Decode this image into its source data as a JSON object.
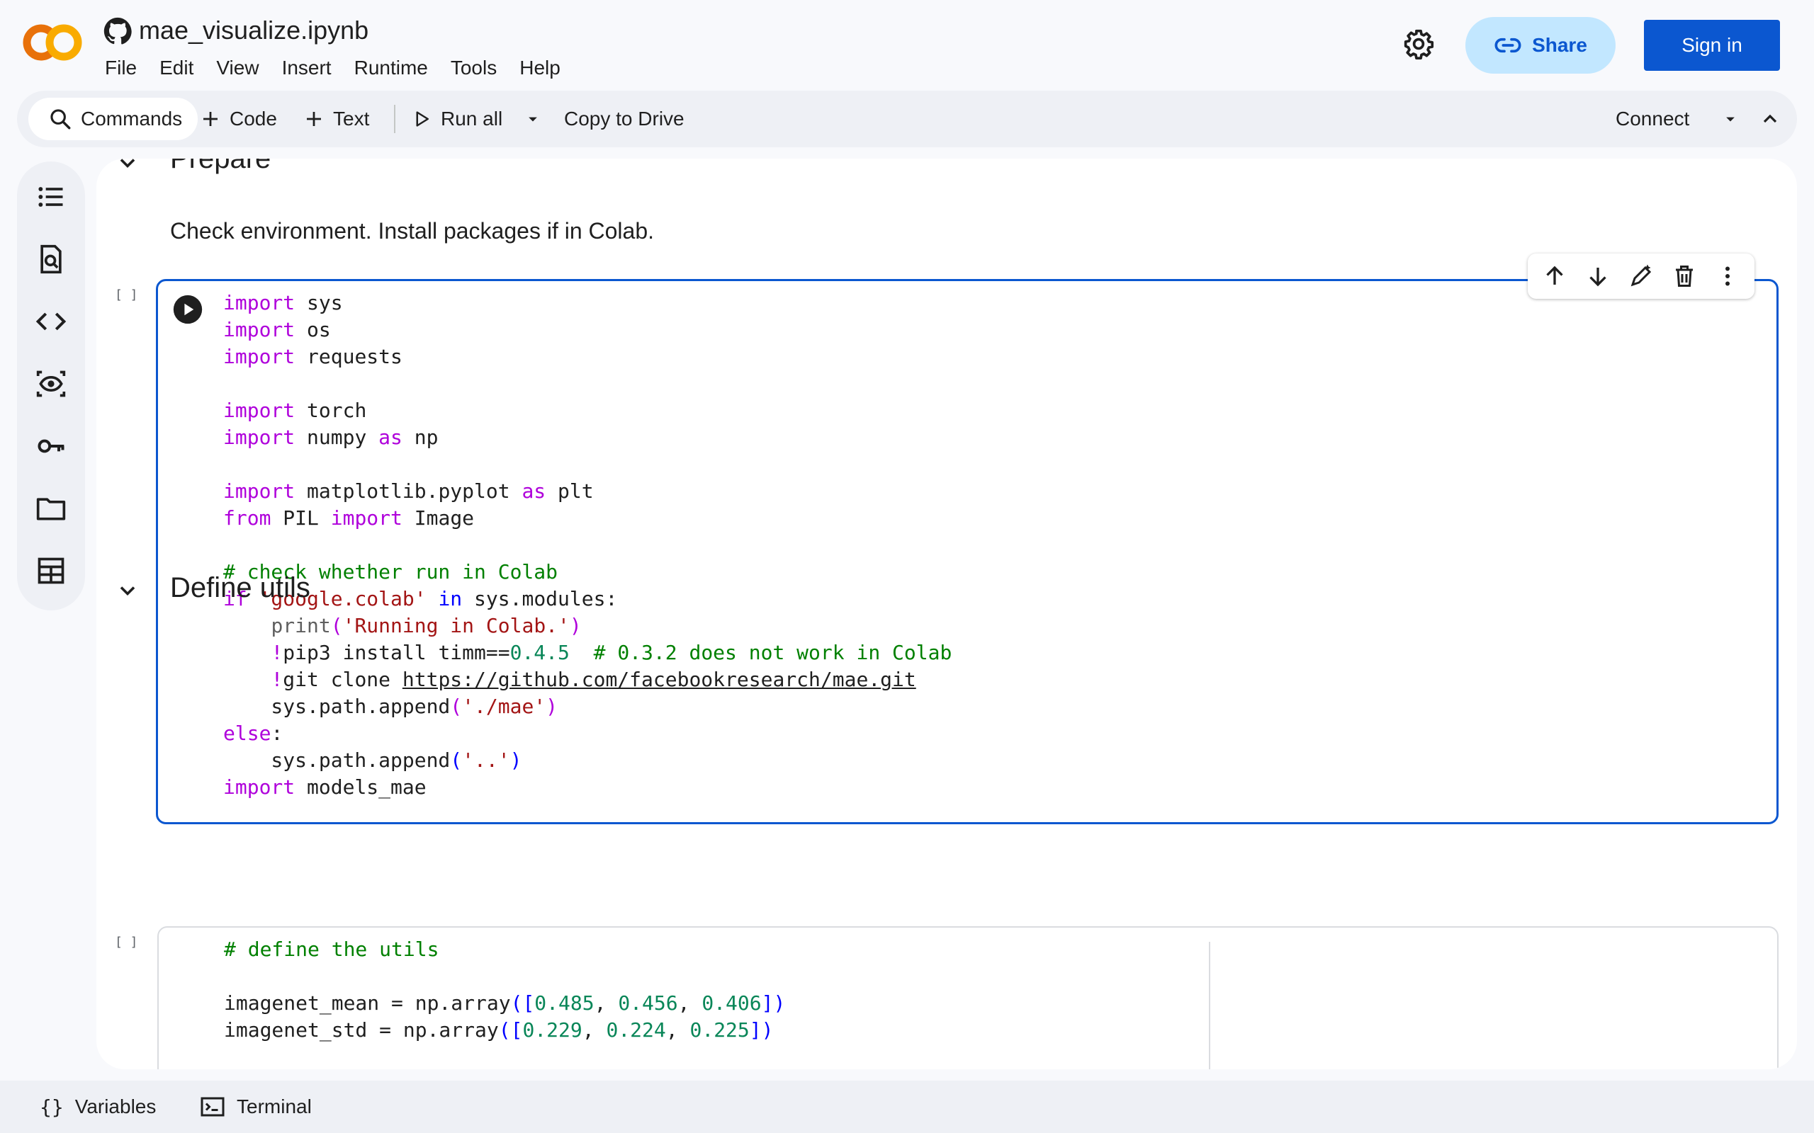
{
  "header": {
    "notebook_title": "mae_visualize.ipynb",
    "share_label": "Share",
    "signin_label": "Sign in",
    "menu": [
      "File",
      "Edit",
      "View",
      "Insert",
      "Runtime",
      "Tools",
      "Help"
    ]
  },
  "toolbar": {
    "commands_label": "Commands",
    "code_label": "Code",
    "text_label": "Text",
    "run_all_label": "Run all",
    "copy_label": "Copy to Drive",
    "connect_label": "Connect"
  },
  "notebook": {
    "section_prepare": "Prepare",
    "prepare_text": "Check environment. Install packages if in Colab.",
    "cell1_count": "[ ]",
    "section_define": "Define utils",
    "cell2_count": "[ ]"
  },
  "cell1_code": {
    "l1": [
      "import",
      " sys"
    ],
    "l2": [
      "import",
      " os"
    ],
    "l3": [
      "import",
      " requests"
    ],
    "l5": [
      "import",
      " torch"
    ],
    "l6": [
      "import",
      " numpy ",
      "as",
      " np"
    ],
    "l8": [
      "import",
      " matplotlib.pyplot ",
      "as",
      " plt"
    ],
    "l9": [
      "from",
      " PIL ",
      "import",
      " Image"
    ],
    "l11": "# check whether run in Colab",
    "l12": [
      "if",
      " ",
      "'google.colab'",
      " ",
      "in",
      " sys.modules:"
    ],
    "l13": [
      "    ",
      "print",
      "(",
      "'Running in Colab.'",
      ")"
    ],
    "l14": [
      "    ",
      "!",
      "pip3 install timm==",
      "0.4.5",
      "  ",
      "# 0.3.2 does not work in Colab"
    ],
    "l15": [
      "    ",
      "!",
      "git clone ",
      "https://github.com/facebookresearch/mae.git"
    ],
    "l16": [
      "    sys.path.append",
      "(",
      "'./mae'",
      ")"
    ],
    "l17": [
      "else",
      ":"
    ],
    "l18": [
      "    sys.path.append",
      "(",
      "'..'",
      ")"
    ],
    "l19": [
      "import",
      " models_mae"
    ]
  },
  "cell2_code": {
    "l1": "# define the utils",
    "l3": [
      "imagenet_mean = np.array",
      "(",
      "[",
      "0.485",
      ", ",
      "0.456",
      ", ",
      "0.406",
      "]",
      ")"
    ],
    "l4": [
      "imagenet_std = np.array",
      "(",
      "[",
      "0.229",
      ", ",
      "0.224",
      ", ",
      "0.225",
      "]",
      ")"
    ]
  },
  "bottombar": {
    "variables_label": "Variables",
    "terminal_label": "Terminal"
  },
  "colors": {
    "accent": "#0b57d0",
    "share_bg": "#c2e7ff",
    "logo_orange": "#f9ab00",
    "logo_dark": "#e8710a"
  },
  "icons": [
    "colab-logo",
    "github-icon",
    "gear-icon",
    "link-icon",
    "search-icon",
    "plus-icon",
    "play-icon",
    "caret-down-icon",
    "chevron-up-icon",
    "toc-icon",
    "find-icon",
    "code-icon",
    "eye-icon",
    "key-icon",
    "folder-icon",
    "table-icon",
    "run-cell-icon",
    "arrow-up-icon",
    "arrow-down-icon",
    "edit-icon",
    "trash-icon",
    "more-icon",
    "chevron-down-icon",
    "braces-icon",
    "terminal-icon"
  ]
}
